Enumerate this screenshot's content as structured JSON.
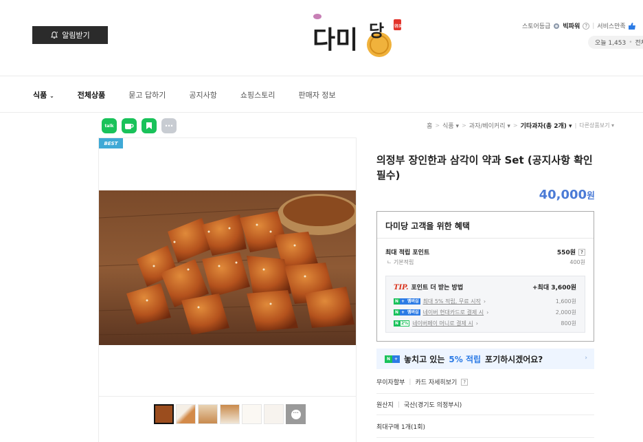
{
  "header": {
    "alarm_button": "알림받기",
    "logo_text": "다미당",
    "logo_badge": "韓果",
    "store_grade_label": "스토어등급",
    "store_grade_value": "빅파워",
    "service_label": "서비스만족",
    "today_label": "오늘 1,453",
    "total_label": "전체"
  },
  "nav": {
    "items": [
      {
        "label": "식품",
        "strong": true
      },
      {
        "label": "전체상품",
        "strong": true
      },
      {
        "label": "묻고 답하기"
      },
      {
        "label": "공지사항"
      },
      {
        "label": "쇼핑스토리"
      },
      {
        "label": "판매자 정보"
      }
    ]
  },
  "share": {
    "icons": [
      "talk-icon",
      "cafe-icon",
      "bookmark-icon",
      "more-icon"
    ],
    "talk_text": "talk"
  },
  "breadcrumb": {
    "home": "홈",
    "level1": "식품",
    "level2": "과자/베이커리",
    "level3": "기타과자(총 2개)",
    "other": "다른상품보기"
  },
  "product": {
    "badge": "BEST",
    "title": "의정부 장인한과 삼각이 약과 Set (공지사항 확인필수)",
    "price": "40,000",
    "currency": "원"
  },
  "benefit": {
    "title": "다미당 고객을 위한 혜택",
    "max_point_label": "최대 적립 포인트",
    "max_point_value": "550원",
    "basic_label": "기본적립",
    "basic_value": "400원",
    "tip_label": "TIP.",
    "tip_text": "포인트 더 받는 방법",
    "tip_max": "+최대 3,600원",
    "lines": [
      {
        "badge": "멤버십",
        "text": "최대 5% 적립, 무료 시작",
        "value": "1,600원"
      },
      {
        "badge": "멤버십",
        "text": "네이버 현대카드로 결제 시",
        "value": "2,000원"
      },
      {
        "badge": "2%",
        "text": "네이버페이 머니로 결제 시",
        "value": "800원"
      }
    ]
  },
  "promo": {
    "pre": "놓치고 있는",
    "accent": "5% 적립",
    "post": "포기하시겠어요?"
  },
  "info": {
    "installment_label": "무이자할부",
    "installment_link": "카드 자세히보기",
    "origin_label": "원산지",
    "origin_value": "국산(경기도 의정부시)",
    "max_purchase": "최대구매 1개(1회)"
  },
  "colors": {
    "price_blue": "#4b7bd6",
    "naver_green": "#19c25a",
    "tip_red": "#d9321c",
    "best_badge": "#3fa9d6"
  }
}
